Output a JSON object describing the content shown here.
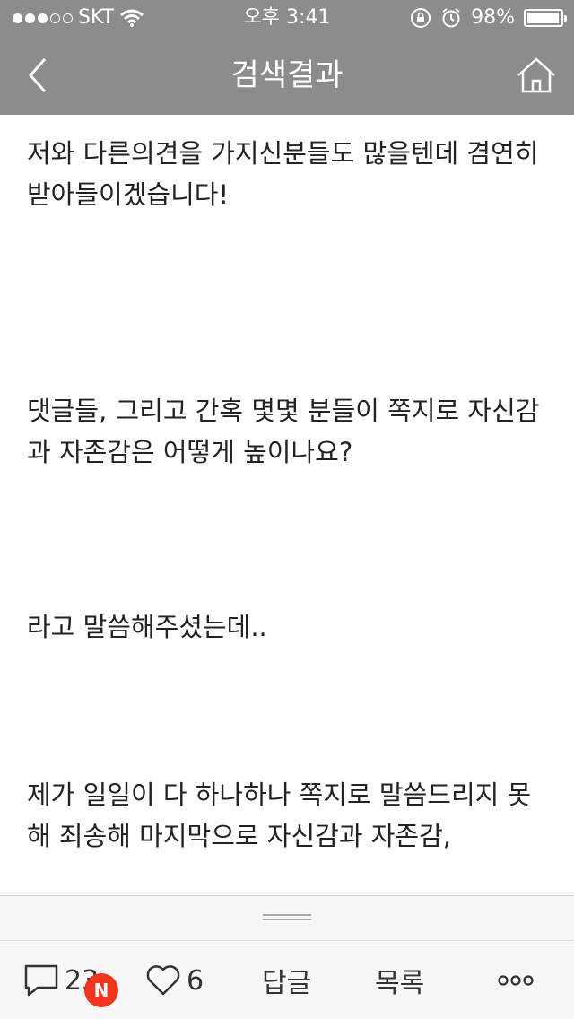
{
  "status_bar": {
    "carrier": "SKT",
    "time": "오후 3:41",
    "battery": "98%",
    "battery_level": 0.98,
    "signal_bars_filled": 3,
    "signal_bars_total": 5
  },
  "nav": {
    "title": "검색결과"
  },
  "content": {
    "paragraphs": [
      "저와 다른의견을 가지신분들도 많을텐데 겸연히 받아들이겠습니다!",
      "댓글들, 그리고 간혹 몇몇 분들이 쪽지로 자신감과 자존감은 어떻게 높이나요?",
      "라고 말씀해주셨는데..",
      "제가 일일이 다 하나하나 쪽지로 말씀드리지 못해 죄송해 마지막으로 자신감과 자존감,"
    ]
  },
  "toolbar": {
    "comment_count": "23",
    "new_badge": "N",
    "like_count": "6",
    "reply_label": "답글",
    "list_label": "목록",
    "more_label": "ooo"
  },
  "colors": {
    "header_bg": "#8c8c8c",
    "badge_bg": "#f0341f",
    "toolbar_bg": "#f7f7f7"
  }
}
